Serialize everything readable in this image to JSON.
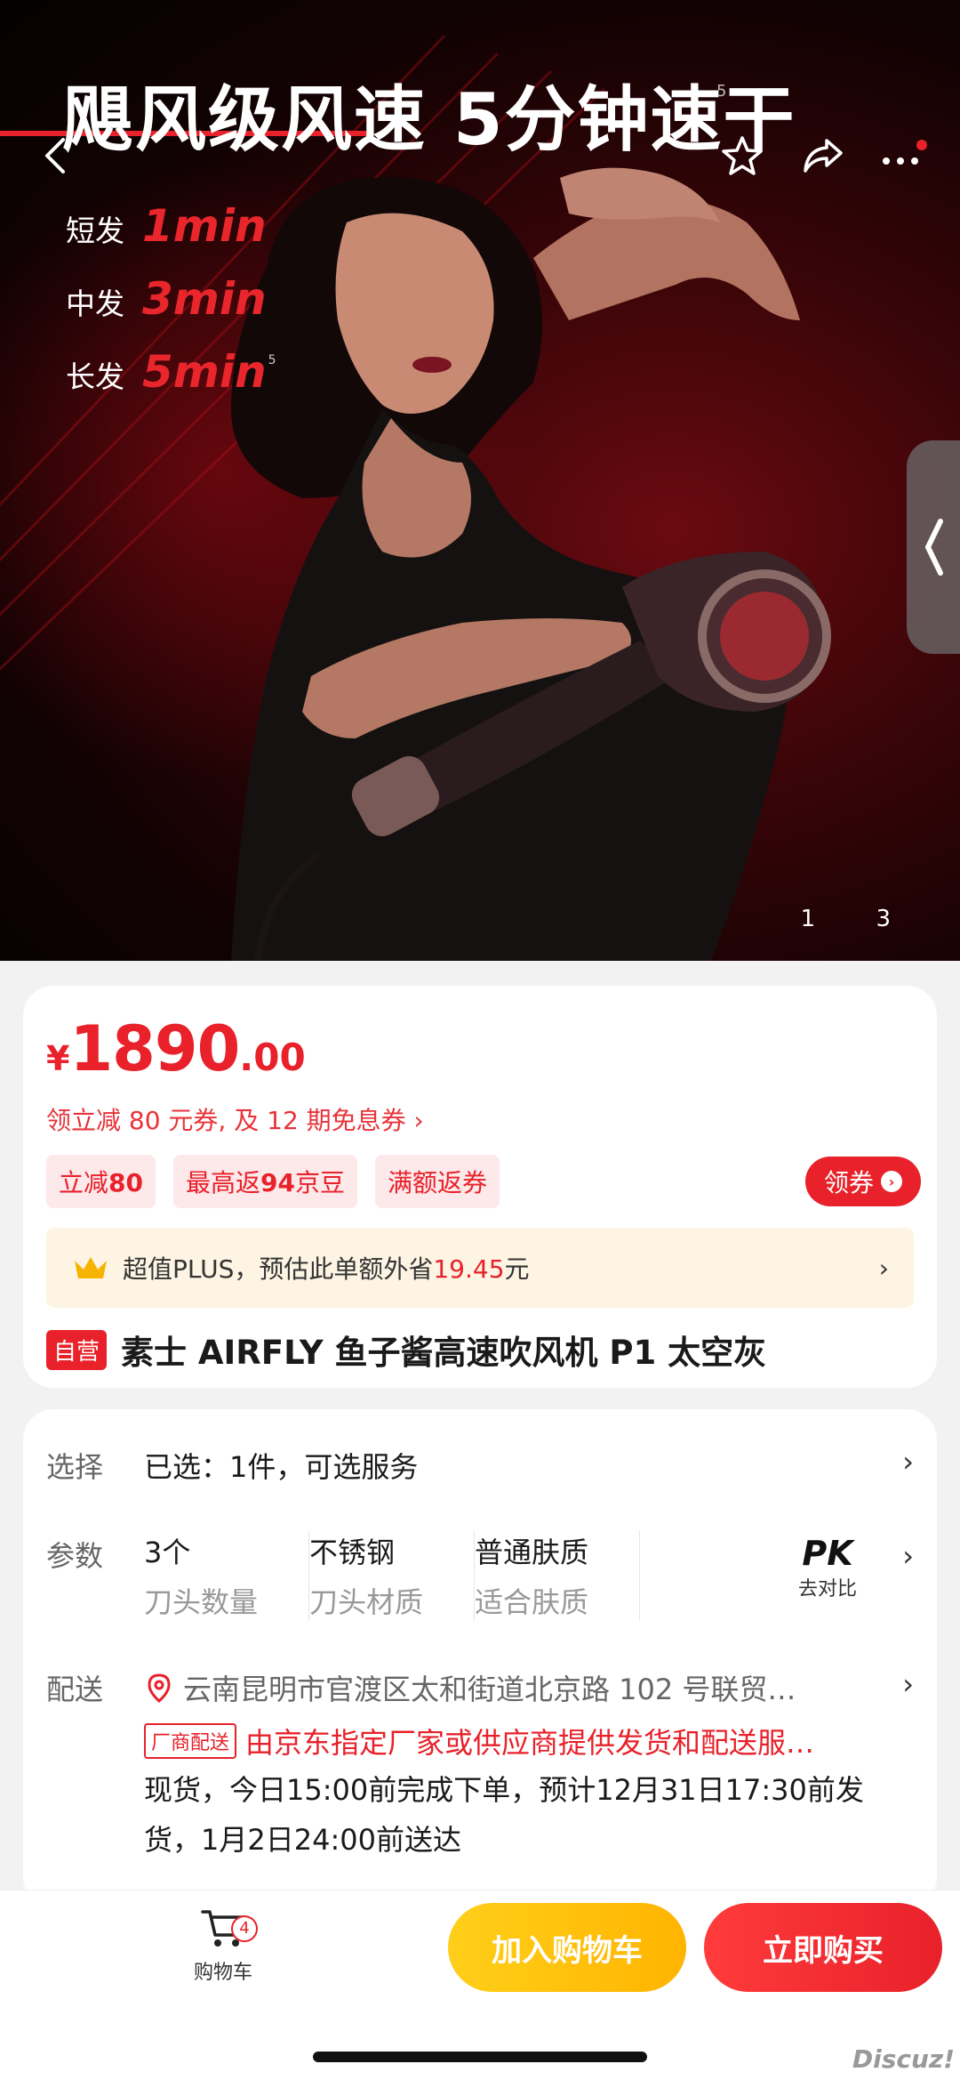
{
  "hero": {
    "headline": "飓风级风速 5分钟速干",
    "headline_sup": "5",
    "stats": [
      {
        "label": "短发",
        "value": "1min",
        "sup": ""
      },
      {
        "label": "中发",
        "value": "3min",
        "sup": ""
      },
      {
        "label": "长发",
        "value": "5min",
        "sup": "5"
      }
    ],
    "page_indicator": "1 3"
  },
  "price": {
    "currency": "¥",
    "integer": "1890",
    "decimal": ".00",
    "coupon_line": "领立减 80 元券, 及 12 期免息券 ›",
    "tags": [
      {
        "prefix": "立减",
        "bold": "80",
        "suffix": ""
      },
      {
        "prefix": "最高返",
        "bold": "94",
        "suffix": "京豆"
      },
      {
        "prefix": "满额返券",
        "bold": "",
        "suffix": ""
      }
    ],
    "get_coupon_label": "领券"
  },
  "plus": {
    "text": "超值PLUS，预估此单额外省",
    "amount": "19.45",
    "unit": "元",
    "chevron": "›"
  },
  "product": {
    "self_tag": "自营",
    "title": "素士 AIRFLY 鱼子酱高速吹风机 P1 太空灰"
  },
  "options": {
    "select_label": "选择",
    "select_value": "已选：1件，可选服务",
    "params_label": "参数",
    "params": [
      {
        "value": "3个",
        "key": "刀头数量"
      },
      {
        "value": "不锈钢",
        "key": "刀头材质"
      },
      {
        "value": "普通肤质",
        "key": "适合肤质"
      }
    ],
    "pk_big": "PK",
    "pk_small": "去对比",
    "delivery_label": "配送",
    "address": "云南昆明市官渡区太和街道北京路 102 号联贸…",
    "factory_tag": "厂商配送",
    "factory_text": "由京东指定厂家或供应商提供发货和配送服…",
    "stock_text": "现货，今日15:00前完成下单，预计12月31日17:30前发货，1月2日24:00前送达"
  },
  "bottom": {
    "cart_label": "购物车",
    "cart_badge": "4",
    "add_cart": "加入购物车",
    "buy_now": "立即购买"
  },
  "watermark": "Discuz!"
}
